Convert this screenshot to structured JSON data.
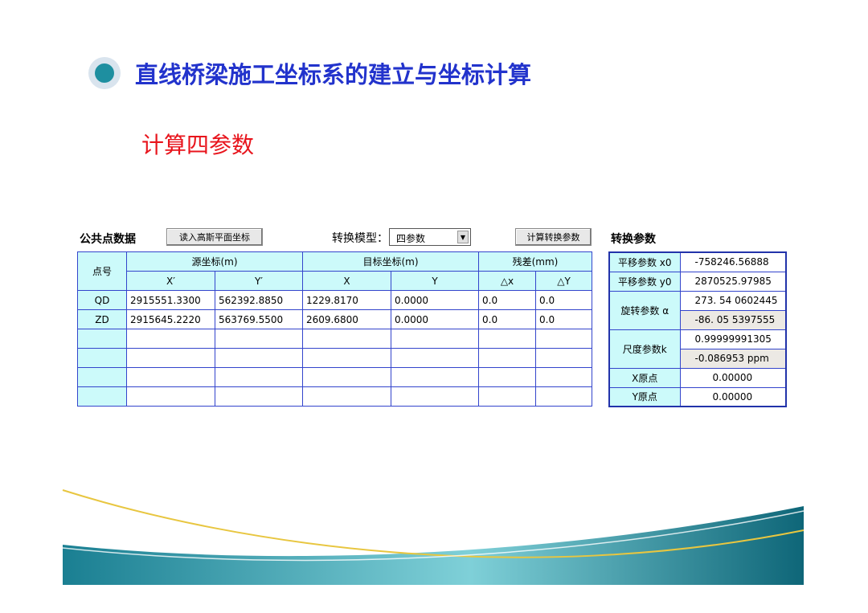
{
  "header": {
    "title": "直线桥梁施工坐标系的建立与坐标计算",
    "subtitle": "计算四参数"
  },
  "toolbar": {
    "common_points_label": "公共点数据",
    "read_button": "读入高斯平面坐标",
    "model_label": "转换模型：",
    "model_value": "四参数",
    "compute_button": "计算转换参数",
    "params_title": "转换参数"
  },
  "grid": {
    "header_row1": {
      "point": "点号",
      "source": "源坐标(m)",
      "target": "目标坐标(m)",
      "residual": "残差(mm)"
    },
    "header_row2": [
      "X′",
      "Y′",
      "X",
      "Y",
      "△x",
      "△Y"
    ],
    "rows": [
      [
        "QD",
        "2915551.3300",
        "562392.8850",
        "1229.8170",
        "0.0000",
        "0.0",
        "0.0"
      ],
      [
        "ZD",
        "2915645.2220",
        "563769.5500",
        "2609.6800",
        "0.0000",
        "0.0",
        "0.0"
      ]
    ]
  },
  "params": {
    "x0_label": "平移参数 x0",
    "x0_value": "-758246.56888",
    "y0_label": "平移参数 y0",
    "y0_value": "2870525.97985",
    "alpha_label": "旋转参数 α",
    "alpha_value1": "273. 54 0602445",
    "alpha_value2": "-86. 05 5397555",
    "k_label": "尺度参数k",
    "k_value1": "0.99999991305",
    "k_value2": "-0.086953 ppm",
    "xorigin_label": "X原点",
    "xorigin_value": "0.00000",
    "yorigin_label": "Y原点",
    "yorigin_value": "0.00000"
  }
}
